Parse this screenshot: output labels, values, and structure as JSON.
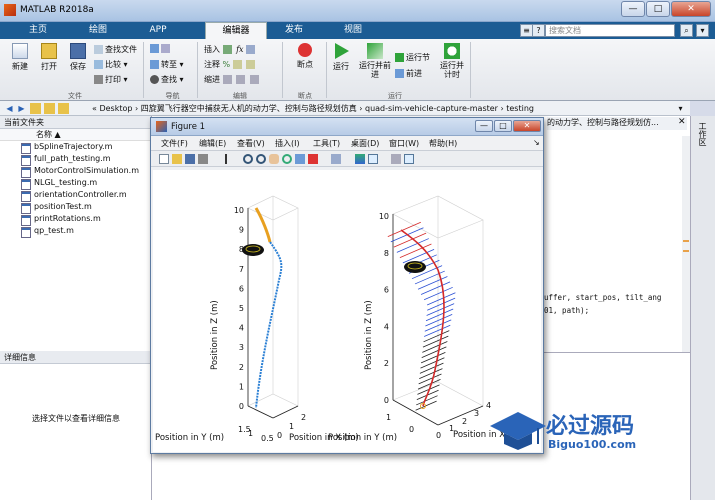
{
  "window": {
    "title": "MATLAB R2018a",
    "min": "—",
    "max": "□",
    "close": "✕"
  },
  "tabs": [
    "主页",
    "绘图",
    "APP",
    "编辑器",
    "发布",
    "视图"
  ],
  "active_tab": 3,
  "search": {
    "placeholder": "搜索文档"
  },
  "ribbon": {
    "file": {
      "new": "新建",
      "open": "打开",
      "save": "保存",
      "find_files": "查找文件",
      "compare": "比较",
      "print": "打印",
      "group": "文件"
    },
    "nav": {
      "goto": "转至",
      "find": "查找",
      "group": "导航"
    },
    "edit": {
      "insert": "插入",
      "comment": "注释",
      "indent": "缩进",
      "group": "编辑"
    },
    "breakpoint": {
      "label": "断点",
      "group": "断点"
    },
    "run": {
      "run": "运行",
      "run_advance": "运行并前进",
      "run_section": "运行节",
      "advance": "前进",
      "run_time": "运行并计时",
      "group": "运行"
    }
  },
  "address": {
    "path": "« Desktop › 四旋翼飞行器空中捕获无人机的动力学、控制与路径规划仿真 › quad-sim-vehicle-capture-master › testing"
  },
  "current_folder": {
    "title": "当前文件夹",
    "col_name": "名称 ▲",
    "files": [
      "bSplineTrajectory.m",
      "full_path_testing.m",
      "MotorControlSimulation.m",
      "NLGL_testing.m",
      "orientationController.m",
      "positionTest.m",
      "printRotations.m",
      "qp_test.m"
    ]
  },
  "details": {
    "title": "详细信息",
    "msg": "选择文件以查看详细信息"
  },
  "editor": {
    "tab": "的动力学、控制与路径规划仿...",
    "line1": "uffer, start_pos, tilt_ang",
    "line2": "01, path);"
  },
  "workspace": {
    "title": "工作区"
  },
  "figure": {
    "title": "Figure 1",
    "menus": [
      "文件(F)",
      "编辑(E)",
      "查看(V)",
      "插入(I)",
      "工具(T)",
      "桌面(D)",
      "窗口(W)",
      "帮助(H)"
    ],
    "left_plot": {
      "zlabel": "Position in Z (m)",
      "ylabel": "Position in Y (m)",
      "xlabel_partial": "Position in X (m)",
      "zticks": [
        "0",
        "1",
        "2",
        "3",
        "4",
        "5",
        "6",
        "7",
        "8",
        "9",
        "10"
      ],
      "yticks": [
        "1.5",
        "1",
        "0.5"
      ],
      "xticks": [
        "0",
        "1",
        "2"
      ]
    },
    "right_plot": {
      "zlabel": "Position in Z (m)",
      "ylabel": "Position in Y (m)",
      "xlabel_partial": "Position in X (m)",
      "zticks": [
        "0",
        "2",
        "4",
        "6",
        "8",
        "10"
      ],
      "yticks": [
        "1",
        "0"
      ],
      "xticks": [
        "0",
        "1",
        "2",
        "3",
        "4"
      ]
    }
  },
  "watermark": {
    "brand": "必过源码",
    "url": "Biguo100.com"
  }
}
